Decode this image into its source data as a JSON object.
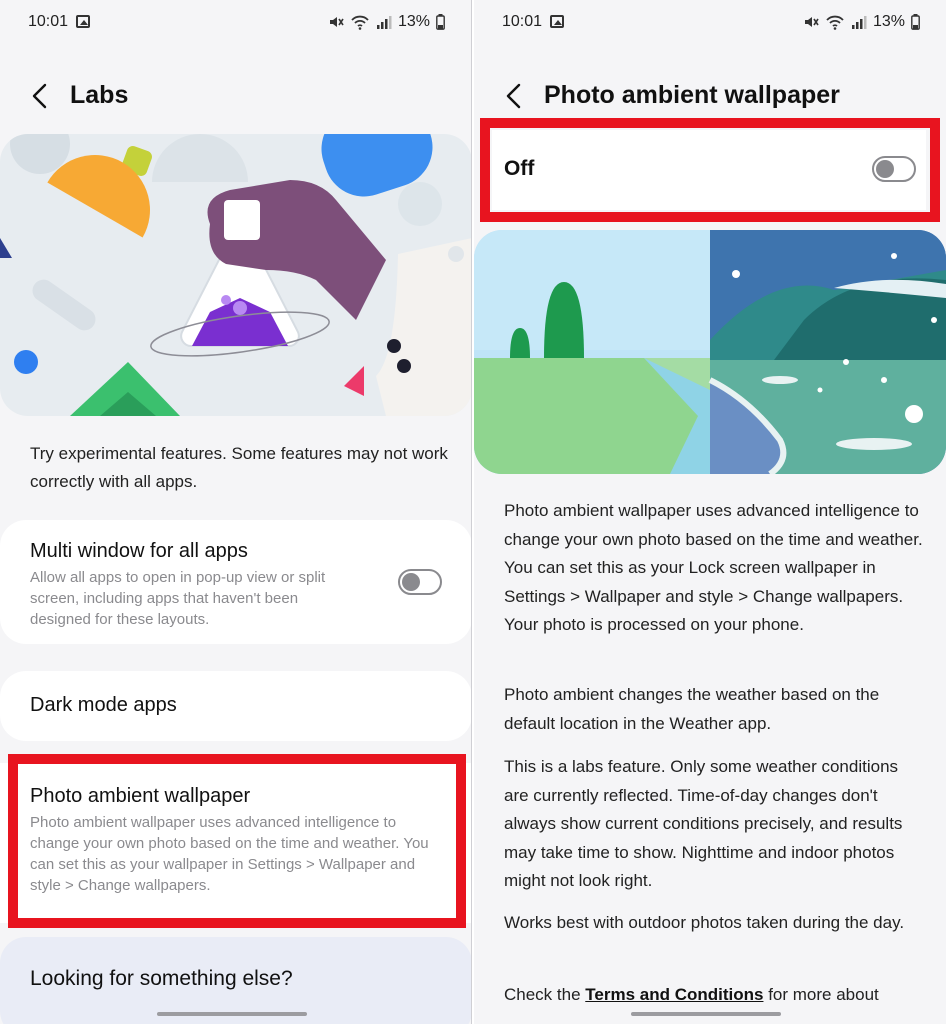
{
  "left": {
    "status": {
      "time": "10:01",
      "battery": "13%"
    },
    "header": {
      "title": "Labs"
    },
    "intro": "Try experimental features. Some features may not work correctly with all apps.",
    "items": [
      {
        "title": "Multi window for all apps",
        "desc": "Allow all apps to open in pop-up view or split screen, including apps that haven't been designed for these layouts.",
        "toggle_on": false
      },
      {
        "title": "Dark mode apps"
      },
      {
        "title": "Photo ambient wallpaper",
        "desc": "Photo ambient wallpaper uses advanced intelligence to change your own photo based on the time and weather. You can set this as your wallpaper in Settings > Wallpaper and style > Change wallpapers."
      }
    ],
    "footer_card": {
      "title": "Looking for something else?"
    }
  },
  "right": {
    "status": {
      "time": "10:01",
      "battery": "13%"
    },
    "header": {
      "title": "Photo ambient wallpaper"
    },
    "switch": {
      "label": "Off",
      "on": false
    },
    "paragraphs": [
      "Photo ambient wallpaper uses advanced intelligence to change your own photo based on the time and weather. You can set this as your Lock screen wallpaper in Settings > Wallpaper and style > Change wallpapers. Your photo is processed on your phone.",
      "Photo ambient changes the weather based on the default location in the Weather app.",
      "This is a labs feature. Only some weather conditions are currently reflected. Time-of-day changes don't always show current conditions precisely, and results may take time to show. Nighttime and indoor photos might not look right.",
      "Works best with outdoor photos taken during the day."
    ],
    "terms": {
      "prefix": "Check the ",
      "link": "Terms and Conditions",
      "suffix": " for more about"
    }
  },
  "colors": {
    "highlight": "#e8141f",
    "toggle_off": "#8a8a8e",
    "background": "#f5f5f7"
  }
}
